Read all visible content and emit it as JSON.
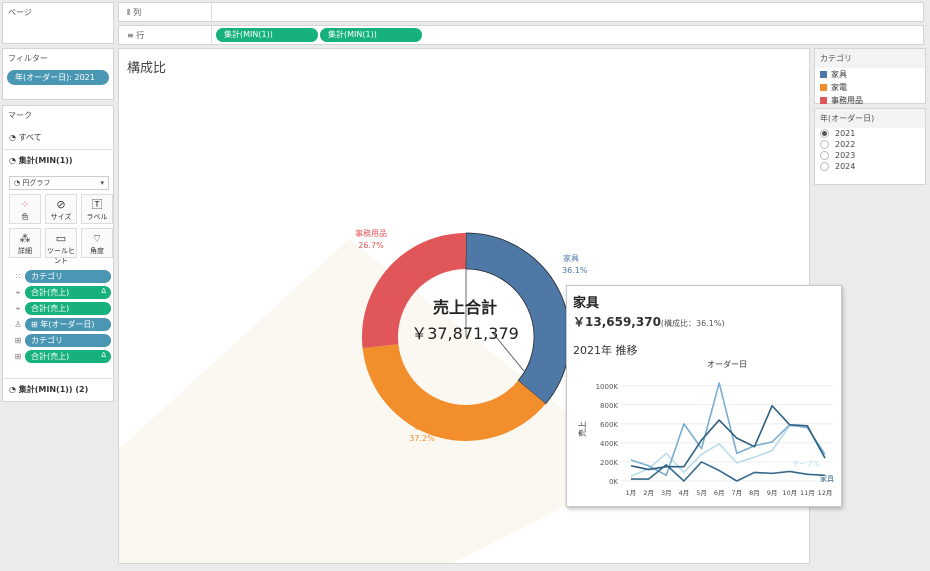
{
  "pages_shelf": {
    "title": "ページ"
  },
  "columns_shelf": {
    "icon": "⦀",
    "label": "列"
  },
  "rows_shelf": {
    "icon": "≡",
    "label": "行",
    "pills": [
      "集計(MIN(1))",
      "集計(MIN(1))"
    ]
  },
  "filters": {
    "title": "フィルター",
    "pill": "年(オーダー日): 2021"
  },
  "marks": {
    "title": "マーク",
    "all_label": "すべて",
    "layer1_label": "集計(MIN(1))",
    "layer2_label": "集計(MIN(1)) (2)",
    "mark_type": "円グラフ",
    "buttons": [
      {
        "label": "色",
        "icon": "color-icon"
      },
      {
        "label": "サイズ",
        "icon": "size-icon"
      },
      {
        "label": "ラベル",
        "icon": "label-icon"
      },
      {
        "label": "詳細",
        "icon": "detail-icon"
      },
      {
        "label": "ツールヒント",
        "icon": "tooltip-icon"
      },
      {
        "label": "角度",
        "icon": "angle-icon"
      }
    ],
    "fields": [
      {
        "icon": "⁙",
        "label": "カテゴリ",
        "color": "blue",
        "delta": ""
      },
      {
        "icon": "⌖",
        "label": "合計(売上)",
        "color": "green",
        "delta": "Δ"
      },
      {
        "icon": "⌖",
        "label": "合計(売上)",
        "color": "green",
        "delta": ""
      },
      {
        "icon": "♙",
        "label": "⊞ 年(オーダー日)",
        "color": "blue",
        "delta": ""
      },
      {
        "icon": "⊞",
        "label": "カテゴリ",
        "color": "blue",
        "delta": ""
      },
      {
        "icon": "⊞",
        "label": "合計(売上)",
        "color": "green",
        "delta": "Δ"
      }
    ]
  },
  "view": {
    "title": "構成比",
    "center_title": "売上合計",
    "center_value": "￥37,871,379"
  },
  "legend": {
    "title": "カテゴリ",
    "items": [
      {
        "label": "家具",
        "color": "#4e79a7"
      },
      {
        "label": "家電",
        "color": "#f28e2b"
      },
      {
        "label": "事務用品",
        "color": "#e15759"
      }
    ]
  },
  "year_filter": {
    "title": "年(オーダー日)",
    "options": [
      {
        "label": "2021",
        "selected": true
      },
      {
        "label": "2022",
        "selected": false
      },
      {
        "label": "2023",
        "selected": false
      },
      {
        "label": "2024",
        "selected": false
      }
    ]
  },
  "chart_data": [
    {
      "type": "pie",
      "subtype": "donut",
      "slices": [
        {
          "label": "家具",
          "pct": 36.1,
          "pct_label": "36.1%",
          "color": "#4e79a7"
        },
        {
          "label": "家電",
          "pct": 37.2,
          "pct_label": "37.2%",
          "color": "#f28e2b"
        },
        {
          "label": "事務用品",
          "pct": 26.7,
          "pct_label": "26.7%",
          "color": "#e15759"
        }
      ]
    },
    {
      "type": "line",
      "title": "オーダー日",
      "ylabel": "売上",
      "x": [
        "1月",
        "2月",
        "3月",
        "4月",
        "5月",
        "6月",
        "7月",
        "8月",
        "9月",
        "10月",
        "11月",
        "12月"
      ],
      "yticks": [
        "0K",
        "200K",
        "400K",
        "600K",
        "800K",
        "1000K"
      ],
      "ylim": [
        0,
        1050000
      ],
      "series": [
        {
          "name": "家具",
          "color": "#2e5f82",
          "values": [
            160000,
            120000,
            150000,
            150000,
            430000,
            640000,
            450000,
            360000,
            790000,
            590000,
            580000,
            240000
          ]
        },
        {
          "name": "テーブル",
          "color": "#b9dceb",
          "values": [
            50000,
            130000,
            290000,
            90000,
            280000,
            390000,
            190000,
            250000,
            320000,
            580000,
            570000,
            240000
          ]
        },
        {
          "name": "",
          "color": "#79aed0",
          "values": [
            220000,
            160000,
            60000,
            600000,
            340000,
            1030000,
            290000,
            370000,
            410000,
            590000,
            560000,
            280000
          ]
        },
        {
          "name": "",
          "color": "#356a8c",
          "values": [
            20000,
            20000,
            170000,
            0,
            200000,
            110000,
            0,
            90000,
            80000,
            100000,
            70000,
            60000
          ]
        }
      ]
    }
  ],
  "tooltip": {
    "title": "家具",
    "value": "￥13,659,370",
    "share": "(構成比：36.1%)",
    "trend_title": "2021年 推移"
  }
}
